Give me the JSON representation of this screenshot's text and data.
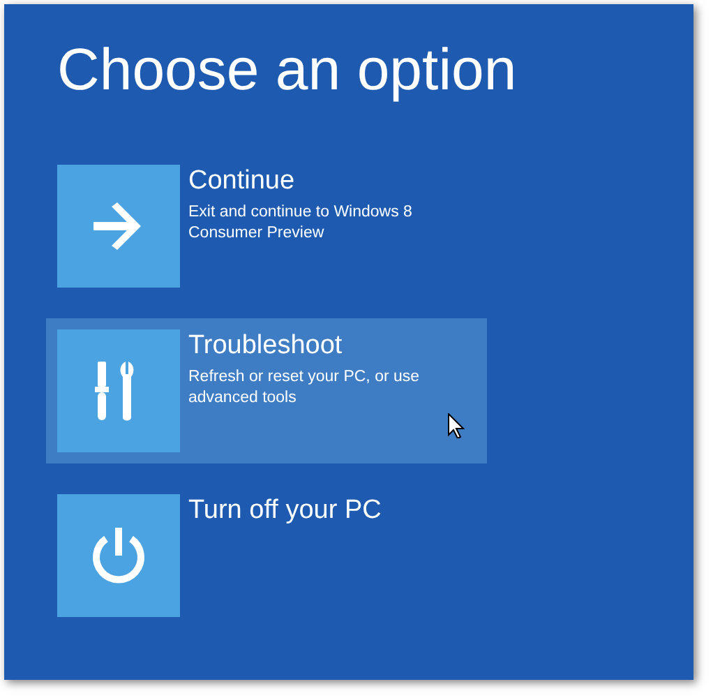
{
  "title": "Choose an option",
  "options": [
    {
      "kind": "arrow",
      "title": "Continue",
      "description": "Exit and continue to Windows 8 Consumer Preview",
      "selected": false
    },
    {
      "kind": "tools",
      "title": "Troubleshoot",
      "description": "Refresh or reset your PC, or use advanced tools",
      "selected": true
    },
    {
      "kind": "power",
      "title": "Turn off your PC",
      "selected": false
    }
  ]
}
